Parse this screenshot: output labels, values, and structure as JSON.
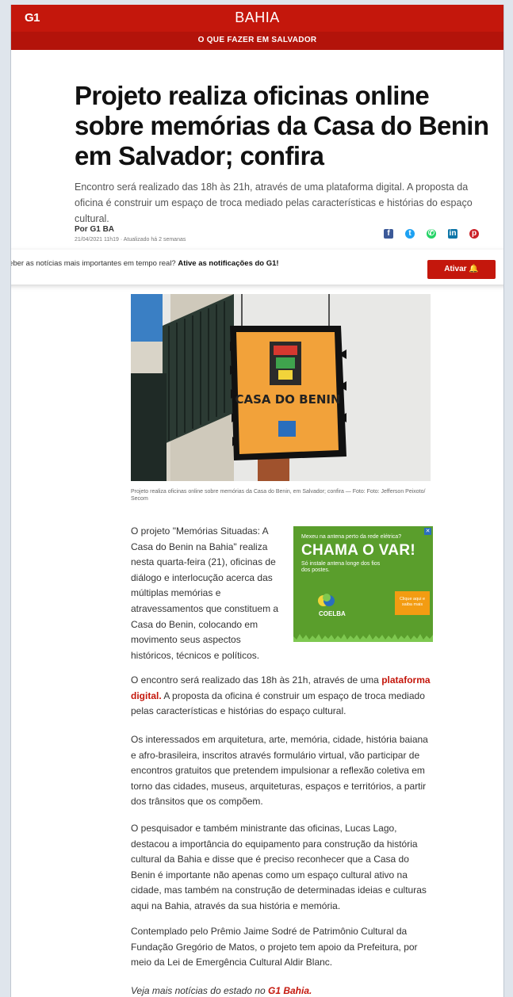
{
  "header": {
    "logo": "G1",
    "region": "BAHIA",
    "section": "O QUE FAZER EM SALVADOR"
  },
  "article": {
    "title": "Projeto realiza oficinas online sobre memórias da Casa do Benin em Salvador; confira",
    "lede": "Encontro será realizado das 18h às 21h, através de uma plataforma digital. A proposta da oficina é construir um espaço de troca mediado pelas características e histórias do espaço cultural.",
    "byline": "Por G1 BA",
    "dateline": "21/04/2021 11h19 · Atualizado há 2 semanas",
    "share_icons": [
      "facebook-icon",
      "twitter-icon",
      "whatsapp-icon",
      "linkedin-icon",
      "pinterest-icon"
    ],
    "photo_sign_text": "CASA DO BENIN",
    "caption": "Projeto realiza oficinas online sobre memórias da Casa do Benin, em Salvador; confira — Foto: Foto: Jefferson Peixoto/ Secom",
    "p1": "O projeto \"Memórias Situadas: A Casa do Benin na Bahia\" realiza nesta quarta-feira (21), oficinas de diálogo e interlocução acerca das múltiplas memórias e atravessamentos que constituem a Casa do Benin, colocando em movimento seus aspectos históricos, técnicos e políticos.",
    "p2_before": "O encontro será realizado das 18h às 21h, através de uma ",
    "p2_link": "plataforma digital.",
    "p2_after": " A proposta da oficina é construir um espaço de troca mediado pelas características e histórias do espaço cultural.",
    "p3": "Os interessados em arquitetura, arte, memória, cidade, história baiana e afro-brasileira, inscritos através formulário virtual, vão participar de encontros gratuitos que pretendem impulsionar a reflexão coletiva em torno das cidades, museus, arquiteturas, espaços e territórios, a partir dos trânsitos que os compõem.",
    "p4": "O pesquisador e também ministrante das oficinas, Lucas Lago, destacou a importância do equipamento para construção da história cultural da Bahia e disse que é preciso reconhecer que a Casa do Benin é importante não apenas como um espaço cultural ativo na cidade, mas também na construção de determinadas ideias e culturas aqui na Bahia, através da sua história e memória.",
    "p5": "Contemplado pelo Prêmio Jaime Sodré de Patrimônio Cultural da Fundação Gregório de Matos, o projeto tem apoio da Prefeitura, por meio da Lei de Emergência Cultural Aldir Blanc.",
    "p6_before": "Veja mais notícias do estado no ",
    "p6_link": "G1 Bahia."
  },
  "notification": {
    "text": "eceber as notícias mais importantes em tempo real?",
    "bold": "Ative as notificações do G1!",
    "button": "Ativar 🔔"
  },
  "ad": {
    "small1": "Mexeu na antena perto da rede elétrica?",
    "big": "CHAMA O VAR!",
    "small2": "Só instale antena longe dos fios dos postes.",
    "brand": "COELBA",
    "cta": "Clique aqui e saiba mais",
    "close": "✕"
  },
  "colors": {
    "brand_red": "#c4170c",
    "ad_green": "#5a9e2c",
    "sign_orange": "#f2a23a"
  }
}
